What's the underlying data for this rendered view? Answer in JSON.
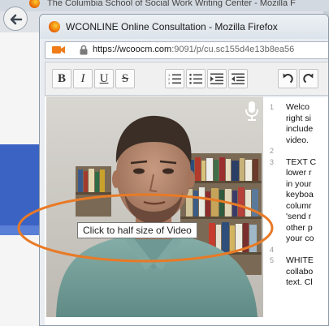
{
  "background_window": {
    "title": "The Columbia School of Social Work Writing Center - Mozilla F"
  },
  "popup": {
    "title": "WCONLINE Online Consultation - Mozilla Firefox",
    "url_host": "https://wcoocm.com",
    "url_rest": ":9091/p/cu.sc155d4e13b8ea56"
  },
  "toolbar": {
    "bold_label": "B",
    "italic_label": "I",
    "underline_label": "U",
    "strike_label": "S"
  },
  "video": {
    "tooltip": "Click to half size of Video"
  },
  "editor": {
    "lines": [
      {
        "n": "1",
        "text": "Welco"
      },
      {
        "n": "",
        "text": "right si"
      },
      {
        "n": "",
        "text": "include"
      },
      {
        "n": "",
        "text": "video."
      },
      {
        "n": "2",
        "text": ""
      },
      {
        "n": "3",
        "text": "TEXT C"
      },
      {
        "n": "",
        "text": "lower r"
      },
      {
        "n": "",
        "text": "in your"
      },
      {
        "n": "",
        "text": "keyboa"
      },
      {
        "n": "",
        "text": "columr"
      },
      {
        "n": "",
        "text": "'send r"
      },
      {
        "n": "",
        "text": "other p"
      },
      {
        "n": "",
        "text": "your co"
      },
      {
        "n": "4",
        "text": ""
      },
      {
        "n": "5",
        "text": "WHITE"
      },
      {
        "n": "",
        "text": "collabo"
      },
      {
        "n": "",
        "text": "text. Cl"
      }
    ]
  },
  "colors": {
    "annotation": "#e87a26",
    "firefox": "#e66000",
    "camera": "#f07d19"
  }
}
